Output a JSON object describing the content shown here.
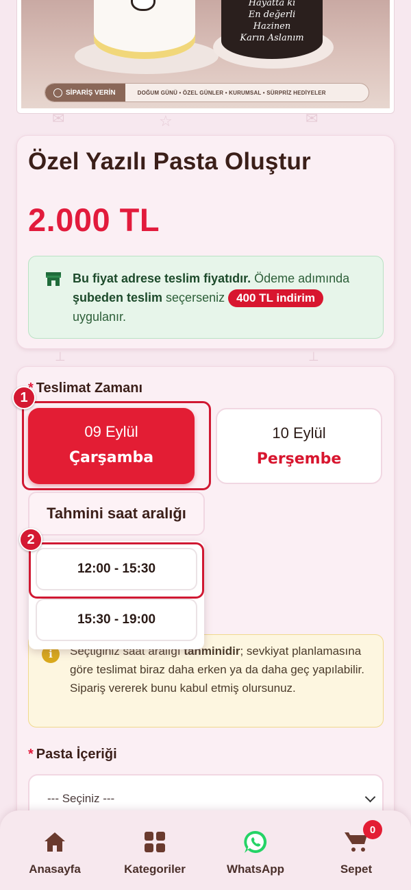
{
  "banner": {
    "cake_text": [
      "En değerli",
      "Hazinen",
      "Karın Aslanım"
    ],
    "top_text": "Hayatta ki",
    "order_button": "SİPARİŞ VERİN",
    "tags": "DOĞUM GÜNÜ • ÖZEL GÜNLER • KURUMSAL • SÜRPRİZ HEDİYELER"
  },
  "product": {
    "title": "Özel Yazılı Pasta Oluştur",
    "price": "2.000 TL",
    "notice": {
      "bold1": "Bu fiyat adrese teslim fiyatıdır.",
      "text1": " Ödeme adımında ",
      "bold2": "şubeden teslim",
      "text2": " seçerseniz ",
      "discount": "400 TL indirim",
      "text3": " uygulanır."
    }
  },
  "delivery": {
    "required_mark": "*",
    "label": "Teslimat Zamanı",
    "dates": [
      {
        "date": "09 Eylül",
        "weekday": "Çarşamba",
        "selected": true
      },
      {
        "date": "10 Eylül",
        "weekday": "Perşembe",
        "selected": false
      }
    ],
    "time_label": "Tahmini saat aralığı",
    "slots": [
      "12:00 - 15:30",
      "15:30 - 19:00"
    ],
    "badges": [
      "1",
      "2"
    ],
    "info": {
      "text1": "Seçtiğiniz saat aralığı ",
      "bold": "tahminidir",
      "text2": "; sevkiyat planlamasına göre teslimat biraz daha erken ya da daha geç yapılabilir. Sipariş vererek bunu kabul etmiş olursunuz."
    }
  },
  "content": {
    "required_mark": "*",
    "label": "Pasta İçeriği",
    "select_value": "--- Seçiniz ---"
  },
  "nav": {
    "items": [
      {
        "label": "Anasayfa",
        "icon": "home-icon"
      },
      {
        "label": "Kategoriler",
        "icon": "grid-icon"
      },
      {
        "label": "WhatsApp",
        "icon": "whatsapp-icon"
      },
      {
        "label": "Sepet",
        "icon": "cart-icon"
      }
    ],
    "cart_count": "0"
  },
  "colors": {
    "accent": "#e31d34",
    "background": "#f7e8ef",
    "success_bg": "#e7f5ea",
    "warning_bg": "#fdf6e0",
    "whatsapp": "#25d366"
  }
}
